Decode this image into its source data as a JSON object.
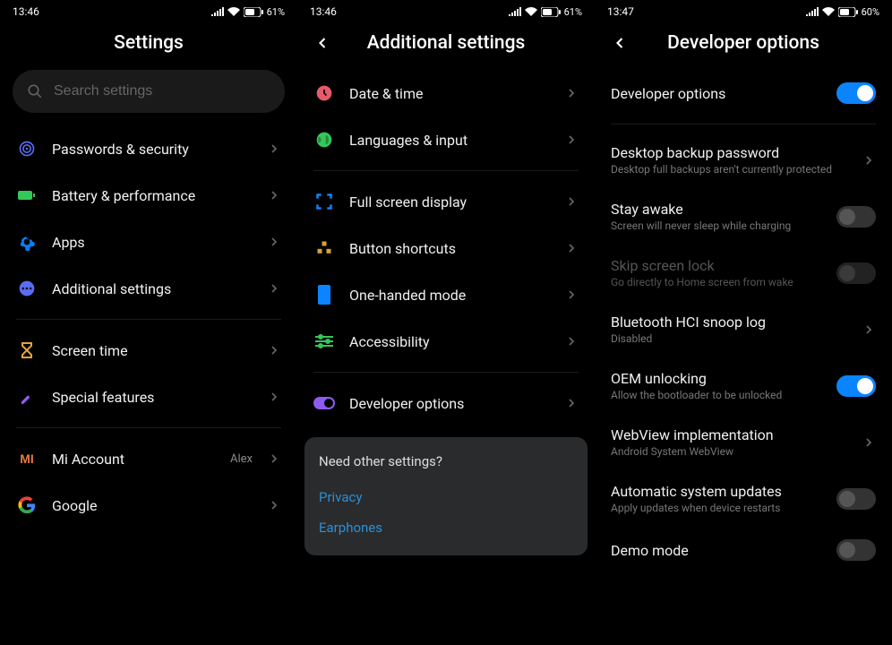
{
  "pane1": {
    "time": "13:46",
    "battery": "61",
    "title": "Settings",
    "search_placeholder": "Search settings",
    "groups": [
      {
        "items": [
          {
            "icon": "shield",
            "color": "#5b6cf0",
            "label": "Passwords & security"
          },
          {
            "icon": "battery-rect",
            "color": "#34c759",
            "label": "Battery & performance"
          },
          {
            "icon": "gear",
            "color": "#0a84ff",
            "label": "Apps"
          },
          {
            "icon": "dots",
            "color": "#5b6cf0",
            "label": "Additional settings"
          }
        ]
      },
      {
        "items": [
          {
            "icon": "hourglass",
            "color": "#e8a33c",
            "label": "Screen time"
          },
          {
            "icon": "wand",
            "color": "#8e5bf0",
            "label": "Special features"
          }
        ]
      },
      {
        "items": [
          {
            "icon": "mi",
            "color": "#e87a3c",
            "label": "Mi Account",
            "value": "Alex"
          },
          {
            "icon": "google",
            "color": "",
            "label": "Google"
          }
        ]
      }
    ]
  },
  "pane2": {
    "time": "13:46",
    "battery": "61",
    "title": "Additional settings",
    "groups": [
      {
        "items": [
          {
            "icon": "clock",
            "color": "#e85a6b",
            "label": "Date & time"
          },
          {
            "icon": "globe",
            "color": "#34c759",
            "label": "Languages & input"
          }
        ]
      },
      {
        "items": [
          {
            "icon": "fullscreen",
            "color": "#0a84ff",
            "label": "Full screen display"
          },
          {
            "icon": "blocks",
            "color": "#d8a038",
            "label": "Button shortcuts"
          },
          {
            "icon": "phone",
            "color": "#0a84ff",
            "label": "One-handed mode"
          },
          {
            "icon": "sliders",
            "color": "#34c759",
            "label": "Accessibility"
          }
        ]
      },
      {
        "items": [
          {
            "icon": "toggle",
            "color": "#8e5bf0",
            "label": "Developer options"
          }
        ]
      }
    ],
    "card": {
      "title": "Need other settings?",
      "links": [
        "Privacy",
        "Earphones"
      ]
    }
  },
  "pane3": {
    "time": "13:47",
    "battery": "60",
    "title": "Developer options",
    "items": [
      {
        "type": "toggle",
        "title": "Developer options",
        "on": true
      },
      {
        "type": "divider"
      },
      {
        "type": "nav",
        "title": "Desktop backup password",
        "sub": "Desktop full backups aren't currently protected"
      },
      {
        "type": "toggle",
        "title": "Stay awake",
        "sub": "Screen will never sleep while charging",
        "on": false
      },
      {
        "type": "toggle",
        "title": "Skip screen lock",
        "sub": "Go directly to Home screen from wake",
        "on": false,
        "disabled": true
      },
      {
        "type": "nav",
        "title": "Bluetooth HCI snoop log",
        "sub": "Disabled"
      },
      {
        "type": "toggle",
        "title": "OEM unlocking",
        "sub": "Allow the bootloader to be unlocked",
        "on": true
      },
      {
        "type": "nav",
        "title": "WebView implementation",
        "sub": "Android System WebView"
      },
      {
        "type": "toggle",
        "title": "Automatic system updates",
        "sub": "Apply updates when device restarts",
        "on": false
      },
      {
        "type": "toggle",
        "title": "Demo mode",
        "on": false
      }
    ]
  }
}
